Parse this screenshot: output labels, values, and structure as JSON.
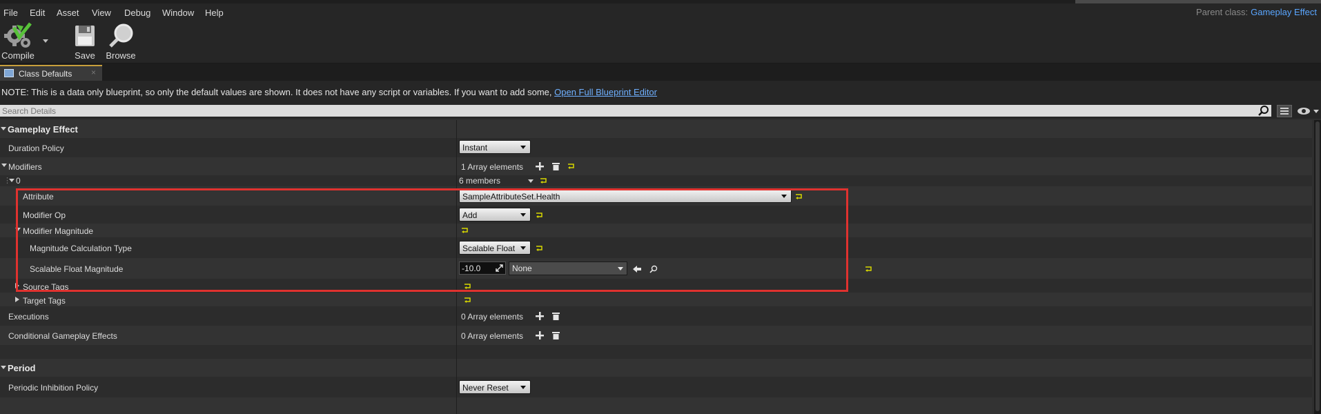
{
  "menu": {
    "items": [
      "File",
      "Edit",
      "Asset",
      "View",
      "Debug",
      "Window",
      "Help"
    ],
    "parent_class_label": "Parent class:",
    "parent_class_value": "Gameplay Effect"
  },
  "toolbar": {
    "compile_label": "Compile",
    "save_label": "Save",
    "browse_label": "Browse"
  },
  "tab": {
    "label": "Class Defaults"
  },
  "note": {
    "text": "NOTE: This is a data only blueprint, so only the default values are shown.  It does not have any script or variables.  If you want to add some, ",
    "link": "Open Full Blueprint Editor"
  },
  "search": {
    "placeholder": "Search Details"
  },
  "details": {
    "gameplay_effect_category": "Gameplay Effect",
    "duration_policy": {
      "label": "Duration Policy",
      "value": "Instant"
    },
    "modifiers": {
      "label": "Modifiers",
      "count_text": "1 Array elements"
    },
    "modifier0": {
      "index_label": "0",
      "members_text": "6 members"
    },
    "attribute": {
      "label": "Attribute",
      "value": "SampleAttributeSet.Health"
    },
    "modifier_op": {
      "label": "Modifier Op",
      "value": "Add"
    },
    "modifier_magnitude": {
      "label": "Modifier Magnitude"
    },
    "magnitude_calc_type": {
      "label": "Magnitude Calculation Type",
      "value": "Scalable Float"
    },
    "scalable_float_magnitude": {
      "label": "Scalable Float Magnitude",
      "value": "-10.0",
      "curve": "None"
    },
    "source_tags": {
      "label": "Source Tags"
    },
    "target_tags": {
      "label": "Target Tags"
    },
    "executions": {
      "label": "Executions",
      "count_text": "0 Array elements"
    },
    "conditional_effects": {
      "label": "Conditional Gameplay Effects",
      "count_text": "0 Array elements"
    },
    "period_category": "Period",
    "periodic_inhibition": {
      "label": "Periodic Inhibition Policy",
      "value": "Never Reset"
    }
  },
  "colors": {
    "accent_link": "#5aa6ff",
    "highlight_box": "#e0322f",
    "reset_arrow": "#d8d800"
  }
}
